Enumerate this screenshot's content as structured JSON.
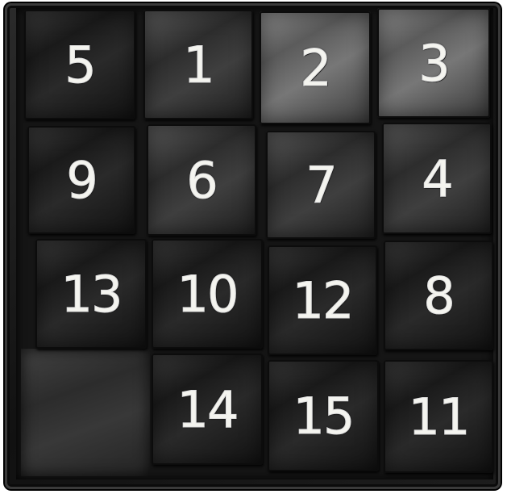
{
  "puzzle": {
    "tiles": [
      {
        "label": "5",
        "shade": "dark"
      },
      {
        "label": "1",
        "shade": "mid"
      },
      {
        "label": "2",
        "shade": "light"
      },
      {
        "label": "3",
        "shade": "light"
      },
      {
        "label": "9",
        "shade": "dark"
      },
      {
        "label": "6",
        "shade": "mid"
      },
      {
        "label": "7",
        "shade": "mid"
      },
      {
        "label": "4",
        "shade": "mid"
      },
      {
        "label": "13",
        "shade": "dark"
      },
      {
        "label": "10",
        "shade": "dark"
      },
      {
        "label": "12",
        "shade": "dark"
      },
      {
        "label": "8",
        "shade": "dark"
      },
      {
        "label": "14",
        "shade": "dark"
      },
      {
        "label": "15",
        "shade": "dark"
      },
      {
        "label": "11",
        "shade": "dark"
      }
    ],
    "empty_position": "bottom-left",
    "colors": {
      "frame": "#111111",
      "tile_text": "#f4f4ef"
    }
  }
}
